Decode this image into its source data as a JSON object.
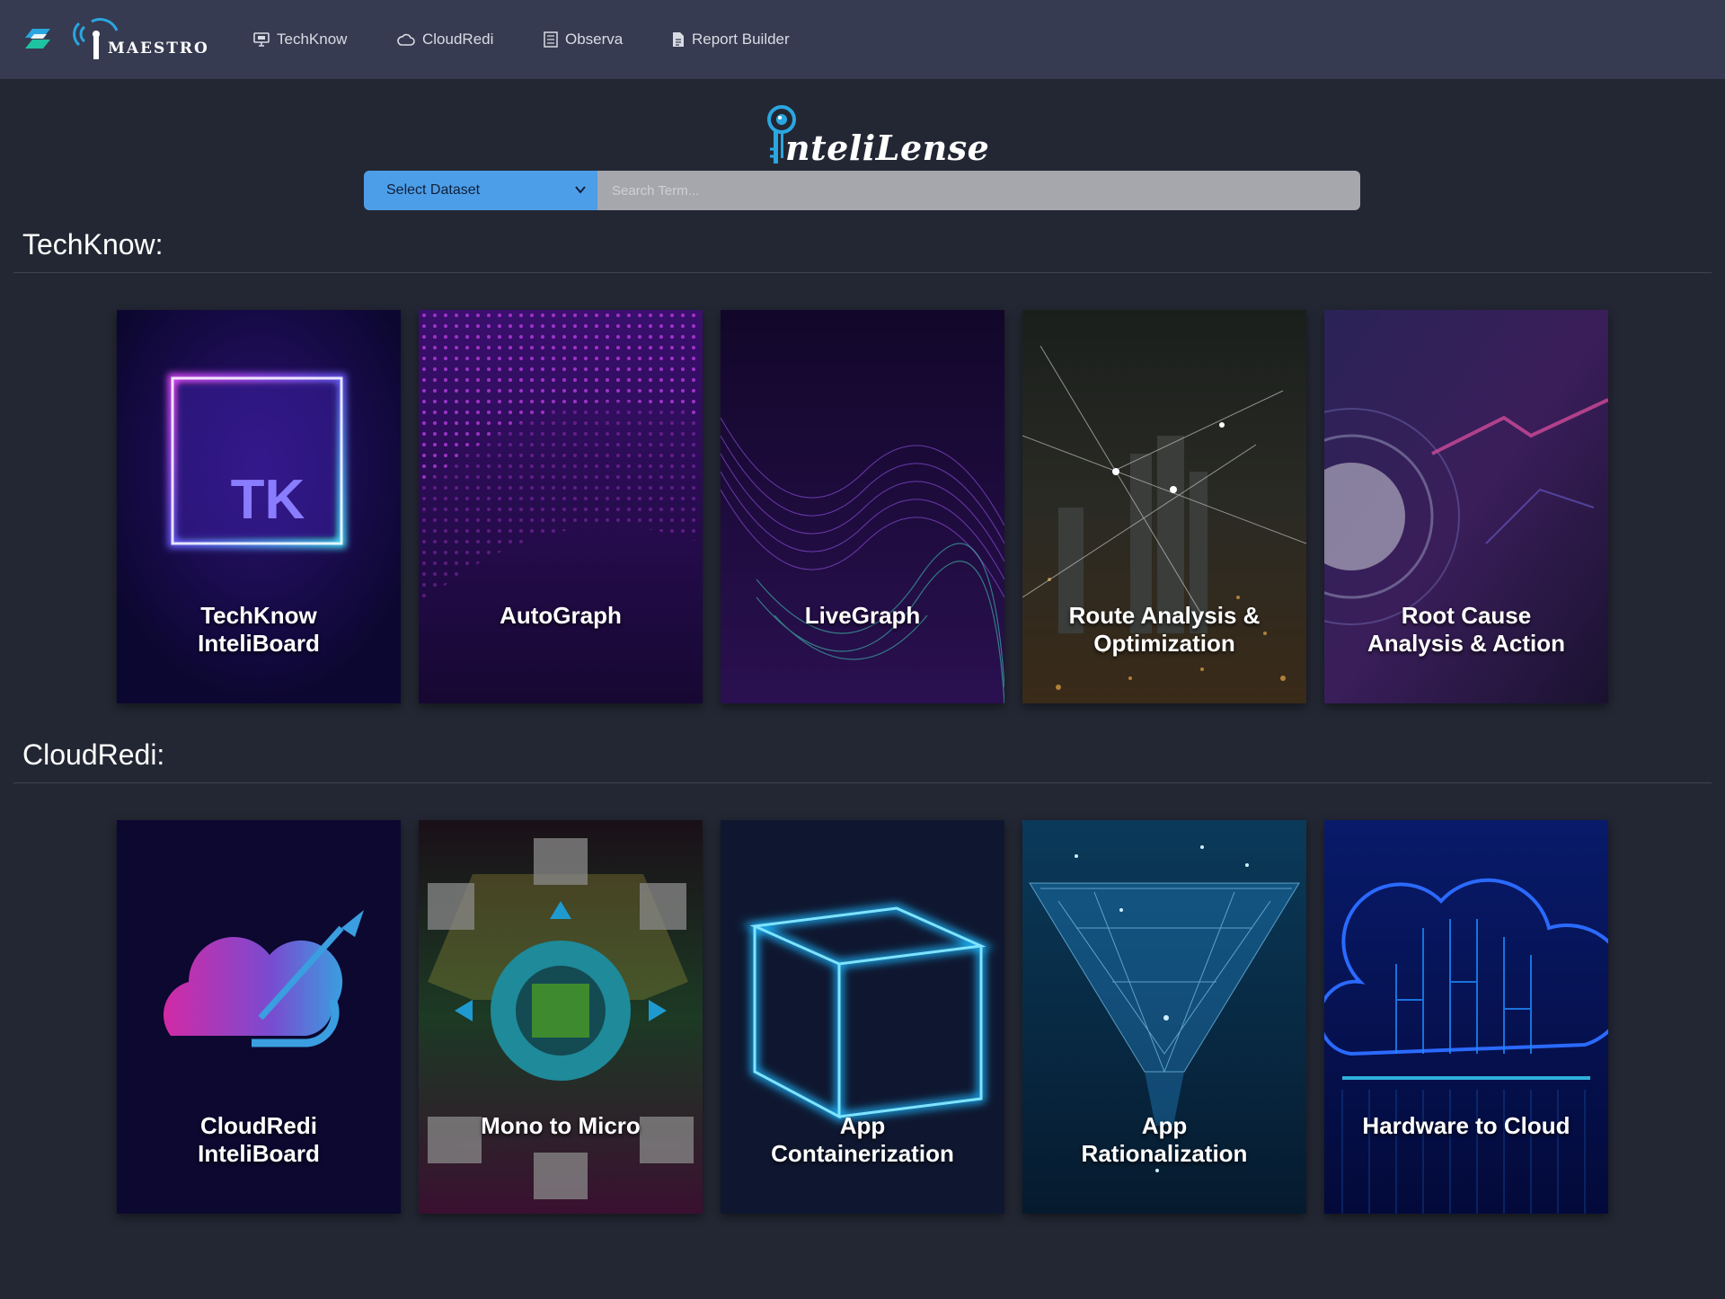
{
  "nav": {
    "brand": "MAESTRO",
    "items": [
      {
        "label": "TechKnow",
        "icon": "monitor-icon"
      },
      {
        "label": "CloudRedi",
        "icon": "cloud-icon"
      },
      {
        "label": "Observa",
        "icon": "list-icon"
      },
      {
        "label": "Report Builder",
        "icon": "report-icon"
      }
    ]
  },
  "search": {
    "logo_text": "nteliLense",
    "select_label": "Select Dataset",
    "placeholder": "Search Term..."
  },
  "sections": [
    {
      "title": "TechKnow:",
      "cards": [
        {
          "line1": "TechKnow",
          "line2": "InteliBoard"
        },
        {
          "line1": "AutoGraph",
          "line2": ""
        },
        {
          "line1": "LiveGraph",
          "line2": ""
        },
        {
          "line1": "Route Analysis &",
          "line2": "Optimization"
        },
        {
          "line1": "Root Cause",
          "line2": "Analysis & Action"
        }
      ]
    },
    {
      "title": "CloudRedi:",
      "cards": [
        {
          "line1": "CloudRedi",
          "line2": "InteliBoard"
        },
        {
          "line1": "Mono to Micro",
          "line2": ""
        },
        {
          "line1": "App",
          "line2": "Containerization"
        },
        {
          "line1": "App",
          "line2": "Rationalization"
        },
        {
          "line1": "Hardware to Cloud",
          "line2": ""
        }
      ]
    }
  ],
  "tk_badge": "TK",
  "colors": {
    "page_bg": "#232733",
    "nav_bg": "#363b51",
    "accent": "#4d9ee8",
    "logo_blue": "#2aa6e0"
  }
}
